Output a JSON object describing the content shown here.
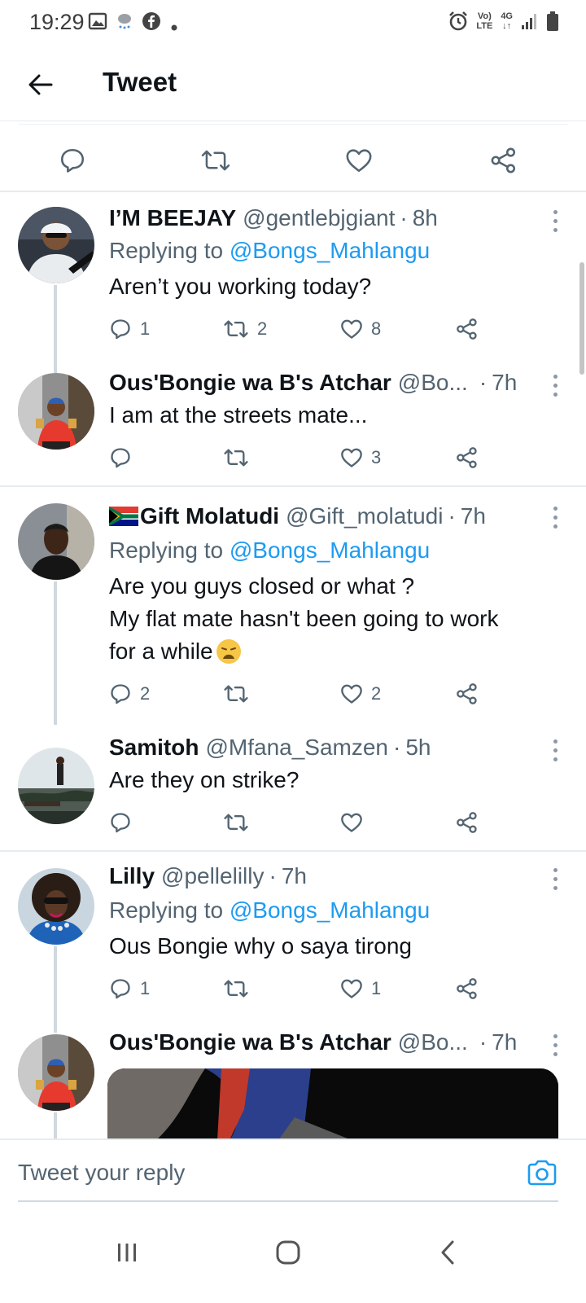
{
  "status_bar": {
    "time": "19:29",
    "net_label_top": "Vo)",
    "net_label_bottom": "LTE",
    "net_type": "4G"
  },
  "header": {
    "title": "Tweet",
    "back_icon": "arrow-left-icon"
  },
  "main_actions": [
    "reply-icon",
    "retweet-icon",
    "like-icon",
    "share-icon"
  ],
  "tweets": [
    {
      "name": "I’M BEEJAY",
      "handle": "@gentlebjgiant",
      "time": "8h",
      "replying_prefix": "Replying to ",
      "replying_to": "@Bongs_Mahlangu",
      "text": "Aren’t you working today?",
      "replies": "1",
      "retweets": "2",
      "likes": "8"
    },
    {
      "name": "Ous'Bongie wa B's Atchar",
      "handle": "@Bo...",
      "time": "7h",
      "text": "I am at the streets mate...",
      "replies": "",
      "retweets": "",
      "likes": "3"
    },
    {
      "name": "Gift Molatudi",
      "handle": "@Gift_molatudi",
      "time": "7h",
      "replying_prefix": "Replying to ",
      "replying_to": "@Bongs_Mahlangu",
      "text_line1": "Are you guys closed or what ?",
      "text_line2": "My flat mate hasn't been going to work",
      "text_line3": "for a while",
      "replies": "2",
      "retweets": "",
      "likes": "2"
    },
    {
      "name": "Samitoh",
      "handle": "@Mfana_Samzen",
      "time": "5h",
      "text": "Are they on strike?",
      "replies": "",
      "retweets": "",
      "likes": ""
    },
    {
      "name": "Lilly",
      "handle": "@pellelilly",
      "time": "7h",
      "replying_prefix": "Replying to ",
      "replying_to": "@Bongs_Mahlangu",
      "text": "Ous Bongie why o saya tirong",
      "replies": "1",
      "retweets": "",
      "likes": "1"
    },
    {
      "name": "Ous'Bongie wa B's Atchar",
      "handle": "@Bo...",
      "time": "7h"
    }
  ],
  "reply_bar": {
    "placeholder": "Tweet your reply"
  },
  "colors": {
    "accent": "#1d9bf0",
    "text": "#0f1419",
    "muted": "#536471",
    "divider": "#e6ecf0"
  }
}
